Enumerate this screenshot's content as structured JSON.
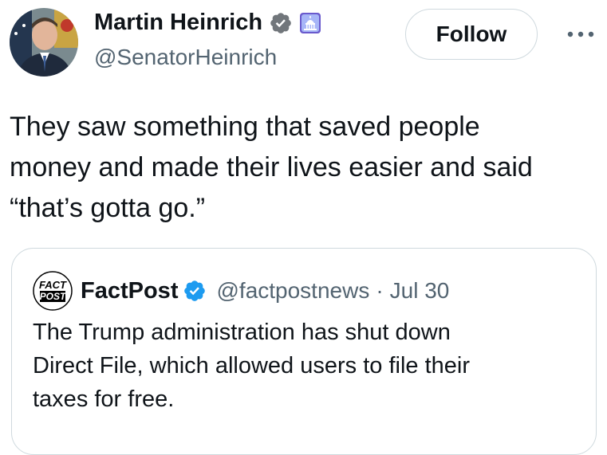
{
  "tweet": {
    "author": {
      "name": "Martin Heinrich",
      "handle": "@SenatorHeinrich",
      "avatar_icon": "avatar-photo-icon",
      "verified_icon": "verified-badge-icon",
      "affiliation_icon": "government-capitol-badge-icon"
    },
    "follow_label": "Follow",
    "more_icon": "more-options-icon",
    "text": "They saw something that saved people\nmoney and made their lives easier and said\n“that’s gotta go.”"
  },
  "quote": {
    "author": {
      "name": "FactPost",
      "handle": "@factpostnews",
      "logo_text_top": "FACT",
      "logo_text_bottom": "POST",
      "verified_icon": "verified-badge-icon"
    },
    "separator": "·",
    "date": "Jul 30",
    "text": "The Trump administration has shut down\nDirect File, which allowed users to file their\ntaxes for free."
  },
  "colors": {
    "text_primary": "#0f1419",
    "text_secondary": "#536471",
    "verified_blue": "#1d9bf0",
    "border": "#cfd9de",
    "gov_badge": "#6a5acd"
  }
}
